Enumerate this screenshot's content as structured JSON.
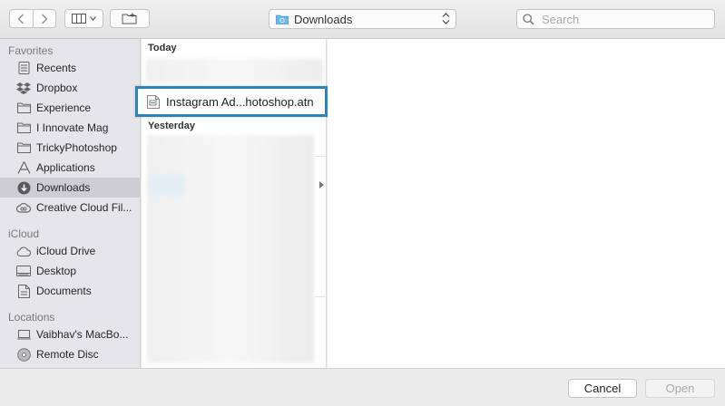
{
  "toolbar": {
    "location": "Downloads",
    "search_placeholder": "Search"
  },
  "sidebar": {
    "sections": [
      {
        "title": "Favorites"
      },
      {
        "title": "iCloud"
      },
      {
        "title": "Locations"
      }
    ],
    "items": [
      {
        "label": "Recents",
        "icon": "recents-icon"
      },
      {
        "label": "Dropbox",
        "icon": "dropbox-icon"
      },
      {
        "label": "Experience",
        "icon": "folder-icon"
      },
      {
        "label": "I Innovate Mag",
        "icon": "folder-icon"
      },
      {
        "label": "TrickyPhotoshop",
        "icon": "folder-icon"
      },
      {
        "label": "Applications",
        "icon": "applications-icon"
      },
      {
        "label": "Downloads",
        "icon": "downloads-icon",
        "selected": true
      },
      {
        "label": "Creative Cloud Fil...",
        "icon": "creative-cloud-icon"
      },
      {
        "label": "iCloud Drive",
        "icon": "cloud-icon"
      },
      {
        "label": "Desktop",
        "icon": "desktop-icon"
      },
      {
        "label": "Documents",
        "icon": "documents-icon"
      },
      {
        "label": "Vaibhav's MacBo...",
        "icon": "laptop-icon"
      },
      {
        "label": "Remote Disc",
        "icon": "disc-icon"
      }
    ]
  },
  "browser": {
    "group_today": "Today",
    "group_yesterday": "Yesterday",
    "selected_file": "Instagram Ad...hotoshop.atn"
  },
  "footer": {
    "cancel_label": "Cancel",
    "open_label": "Open"
  },
  "colors": {
    "highlight_border": "#2a86b8",
    "sidebar_bg": "#e6e5ea",
    "selected_bg": "#cfcdd4"
  }
}
